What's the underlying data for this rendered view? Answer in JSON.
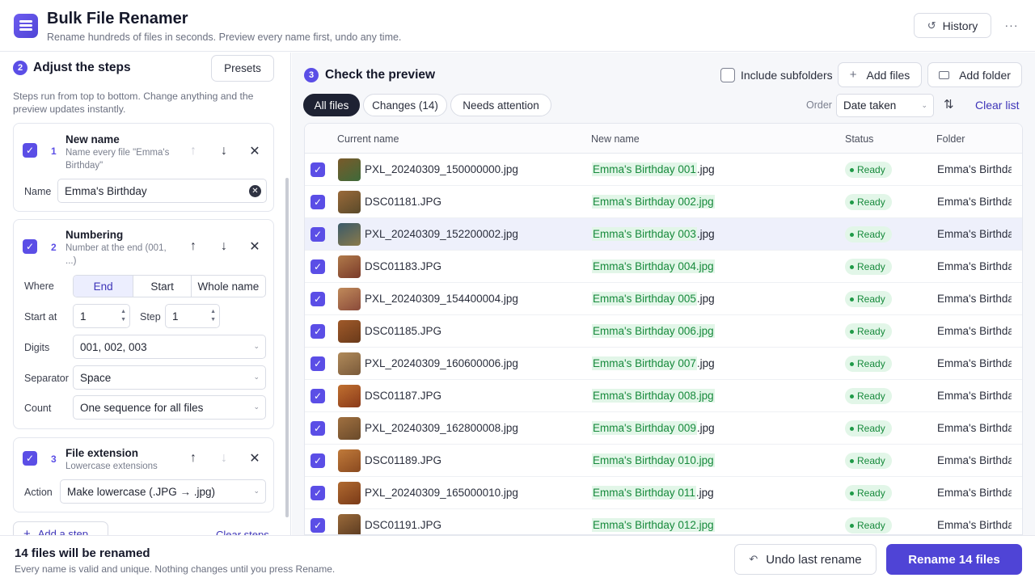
{
  "app": {
    "title": "Bulk File Renamer",
    "subtitle": "Rename hundreds of files in seconds. Preview every name first, undo any time.",
    "history_label": "History",
    "more_label": "···"
  },
  "left": {
    "step_badge": "2",
    "title": "Adjust the steps",
    "presets_label": "Presets",
    "description": "Steps run from top to bottom. Change anything and the preview updates instantly.",
    "steps": [
      {
        "index": "1",
        "title": "New name",
        "subtitle": "Name every file \"Emma's Birthday\"",
        "checked": true,
        "name_label": "Name",
        "name_value": "Emma's Birthday"
      },
      {
        "index": "2",
        "title": "Numbering",
        "subtitle": "Number at the end (001, ...)",
        "checked": true,
        "where_label": "Where",
        "where_options": [
          "End",
          "Start",
          "Whole name"
        ],
        "where_selected": "End",
        "start_label": "Start at",
        "start_value": "1",
        "step_label": "Step",
        "step_value": "1",
        "digits_label": "Digits",
        "digits_value": "001, 002, 003",
        "separator_label": "Separator",
        "separator_value": "Space",
        "count_label": "Count",
        "count_value": "One sequence for all files"
      },
      {
        "index": "3",
        "title": "File extension",
        "subtitle": "Lowercase extensions",
        "checked": true,
        "action_label": "Action",
        "action_value": "Make lowercase (.JPG → .jpg)"
      }
    ],
    "add_step_label": "Add a step",
    "clear_steps_label": "Clear steps"
  },
  "right": {
    "step_badge": "3",
    "title": "Check the preview",
    "include_subfolders_label": "Include subfolders",
    "add_files_label": "Add files",
    "add_folder_label": "Add folder",
    "filters": [
      "All files",
      "Changes (14)",
      "Needs attention"
    ],
    "active_filter": "All files",
    "order_label": "Order",
    "order_value": "Date taken",
    "clear_list_label": "Clear list",
    "columns": [
      "Current name",
      "New name",
      "Status",
      "Folder"
    ],
    "rows": [
      {
        "current": "PXL_20240309_150000000.jpg",
        "new_hl": "Emma's Birthday 001",
        "new_rest": ".jpg",
        "status": "Ready",
        "folder": "Emma's Birthday"
      },
      {
        "current": "DSC01181.JPG",
        "new_hl": "Emma's Birthday 002.jpg",
        "new_rest": "",
        "status": "Ready",
        "folder": "Emma's Birthday"
      },
      {
        "current": "PXL_20240309_152200002.jpg",
        "new_hl": "Emma's Birthday 003",
        "new_rest": ".jpg",
        "status": "Ready",
        "folder": "Emma's Birthday"
      },
      {
        "current": "DSC01183.JPG",
        "new_hl": "Emma's Birthday 004.jpg",
        "new_rest": "",
        "status": "Ready",
        "folder": "Emma's Birthday"
      },
      {
        "current": "PXL_20240309_154400004.jpg",
        "new_hl": "Emma's Birthday 005",
        "new_rest": ".jpg",
        "status": "Ready",
        "folder": "Emma's Birthday"
      },
      {
        "current": "DSC01185.JPG",
        "new_hl": "Emma's Birthday 006.jpg",
        "new_rest": "",
        "status": "Ready",
        "folder": "Emma's Birthday"
      },
      {
        "current": "PXL_20240309_160600006.jpg",
        "new_hl": "Emma's Birthday 007",
        "new_rest": ".jpg",
        "status": "Ready",
        "folder": "Emma's Birthday"
      },
      {
        "current": "DSC01187.JPG",
        "new_hl": "Emma's Birthday 008.jpg",
        "new_rest": "",
        "status": "Ready",
        "folder": "Emma's Birthday"
      },
      {
        "current": "PXL_20240309_162800008.jpg",
        "new_hl": "Emma's Birthday 009",
        "new_rest": ".jpg",
        "status": "Ready",
        "folder": "Emma's Birthday"
      },
      {
        "current": "DSC01189.JPG",
        "new_hl": "Emma's Birthday 010.jpg",
        "new_rest": "",
        "status": "Ready",
        "folder": "Emma's Birthday"
      },
      {
        "current": "PXL_20240309_165000010.jpg",
        "new_hl": "Emma's Birthday 011",
        "new_rest": ".jpg",
        "status": "Ready",
        "folder": "Emma's Birthday"
      },
      {
        "current": "DSC01191.JPG",
        "new_hl": "Emma's Birthday 012.jpg",
        "new_rest": "",
        "status": "Ready",
        "folder": "Emma's Birthday"
      }
    ]
  },
  "footer": {
    "title": "14 files will be renamed",
    "subtitle": "Every name is valid and unique. Nothing changes until you press Rename.",
    "undo_label": "Undo last rename",
    "rename_label": "Rename 14 files"
  },
  "colors": {
    "accent": "#4f44d6",
    "ready_bg": "#e2f6e8",
    "ready_text": "#178a3c"
  }
}
